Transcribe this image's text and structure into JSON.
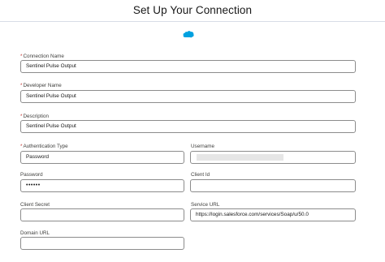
{
  "header": {
    "title": "Set Up Your Connection",
    "logo_icon": "salesforce-cloud-icon",
    "logo_color": "#00a1e0"
  },
  "form": {
    "connection_name": {
      "label": "Connection Name",
      "required": true,
      "value": "Sentinel Pulse Output"
    },
    "developer_name": {
      "label": "Developer Name",
      "required": true,
      "value": "Sentinel Pulse Output"
    },
    "description": {
      "label": "Description",
      "required": true,
      "value": "Sentinel Pulse Output"
    },
    "authentication_type": {
      "label": "Authentication Type",
      "required": true,
      "value": "Password"
    },
    "username": {
      "label": "Username",
      "value": ""
    },
    "password": {
      "label": "Password",
      "value": "••••••"
    },
    "client_id": {
      "label": "Client Id",
      "value": ""
    },
    "client_secret": {
      "label": "Client Secret",
      "value": ""
    },
    "service_url": {
      "label": "Service URL",
      "value": "https://login.salesforce.com/services/Soap/u/50.0"
    },
    "domain_url": {
      "label": "Domain URL",
      "value": ""
    }
  },
  "colors": {
    "required_marker": "#c23934",
    "input_border": "#8c8c8c"
  }
}
